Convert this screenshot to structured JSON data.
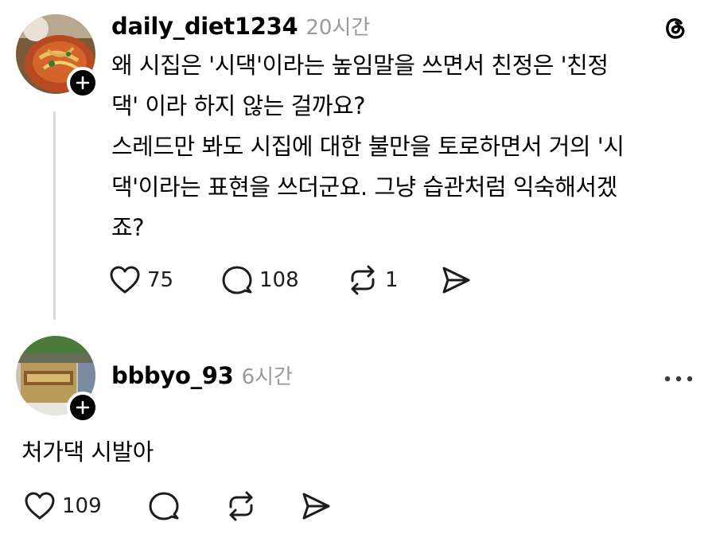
{
  "post1": {
    "username": "daily_diet1234",
    "time": "20시간",
    "lines": [
      "왜 시집은 '시댁'이라는 높임말을 쓰면서 친정은 '친정",
      "댁' 이라 하지 않는 걸까요?",
      "스레드만 봐도 시집에 대한 불만을 토로하면서 거의 '시",
      "댁'이라는 표현을 쓰더군요. 그냥 습관처럼 익숙해서겠",
      "죠?"
    ],
    "likes": "75",
    "replies": "108",
    "reposts": "1"
  },
  "post2": {
    "username": "bbbyo_93",
    "time": "6시간",
    "text": "처가댁 시발아",
    "likes": "109"
  }
}
